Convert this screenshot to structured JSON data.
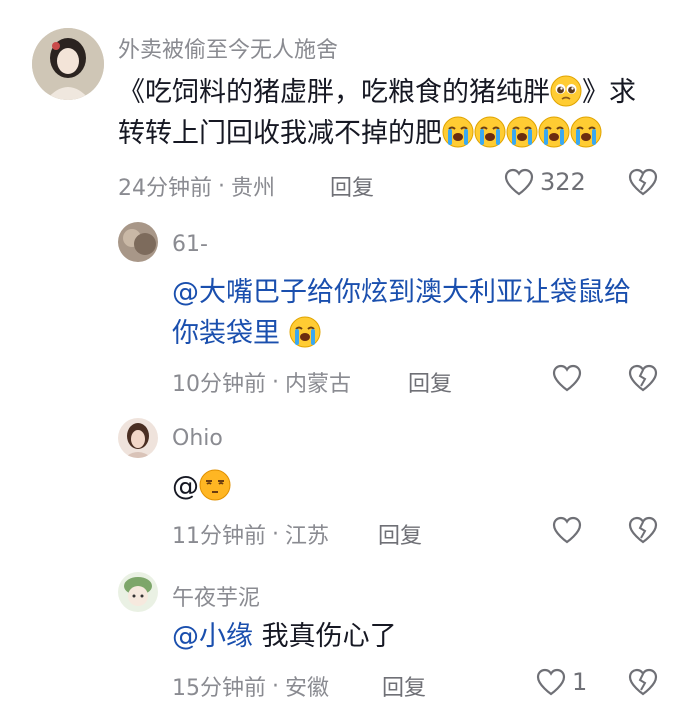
{
  "comments": [
    {
      "username": "外卖被偷至今无人施舍",
      "line1": "《吃饲料的猪虚胖，吃粮食的猪纯胖",
      "line1_tail": "》求",
      "line2": "转转上门回收我减不掉的肥",
      "time": "24分钟前",
      "location": "贵州",
      "reply_label": "回复",
      "like_count": "322",
      "emoji_line1": "pleading-face",
      "emoji_line2": [
        "loudly-crying-face",
        "loudly-crying-face",
        "loudly-crying-face",
        "loudly-crying-face",
        "loudly-crying-face"
      ]
    }
  ],
  "replies": [
    {
      "username": "61-",
      "mention": "@大嘴巴子给你炫到澳大利亚让袋鼠给",
      "line2": "你装袋里",
      "time": "10分钟前",
      "location": "内蒙古",
      "reply_label": "回复",
      "like_count": "",
      "emoji": "loudly-crying-face"
    },
    {
      "username": "Ohio",
      "mention": "@",
      "time": "11分钟前",
      "location": "江苏",
      "reply_label": "回复",
      "like_count": "",
      "emoji": "unamused-face"
    },
    {
      "username": "午夜芋泥",
      "mention": "@小缘",
      "text": " 我真伤心了",
      "time": "15分钟前",
      "location": "安徽",
      "reply_label": "回复",
      "like_count": "1"
    }
  ],
  "separator": "·",
  "colors": {
    "mention": "#1a4fae",
    "meta": "#8a8b91",
    "text": "#161823"
  }
}
